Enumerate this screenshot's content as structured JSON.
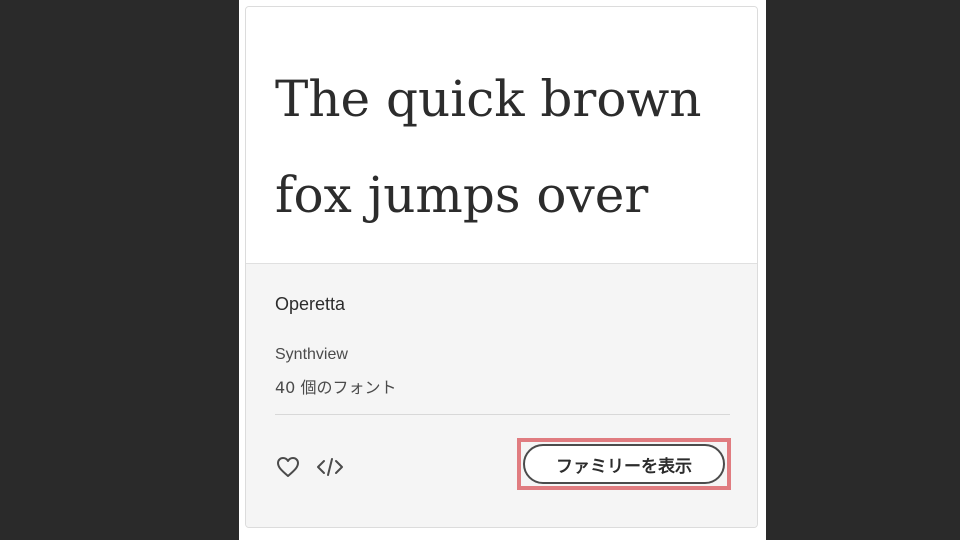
{
  "card": {
    "preview_text": "The quick brown fox jumps over the lazy dog",
    "family_name": "Operetta",
    "foundry": "Synthview",
    "font_count": "40 個のフォント",
    "view_family_label": "ファミリーを表示"
  },
  "icons": {
    "favorite": "heart-icon",
    "embed": "code-icon"
  },
  "colors": {
    "background": "#2a2a2a",
    "highlight": "#e07c80",
    "text": "#2c2c2c"
  }
}
